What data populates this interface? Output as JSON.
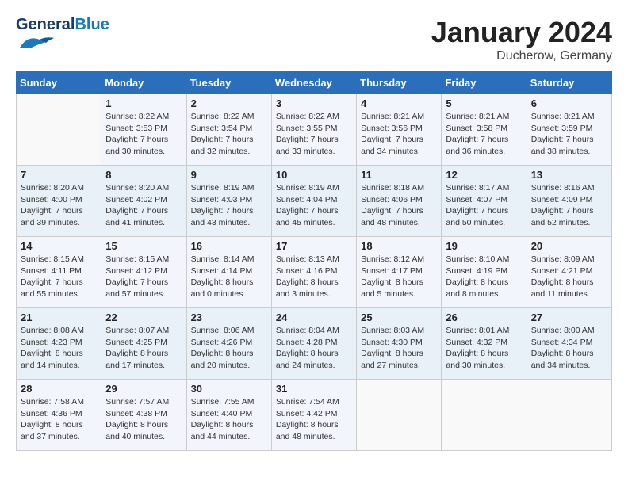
{
  "header": {
    "logo_general": "General",
    "logo_blue": "Blue",
    "month_title": "January 2024",
    "location": "Ducherow, Germany"
  },
  "days_of_week": [
    "Sunday",
    "Monday",
    "Tuesday",
    "Wednesday",
    "Thursday",
    "Friday",
    "Saturday"
  ],
  "weeks": [
    [
      {
        "day": "",
        "sunrise": "",
        "sunset": "",
        "daylight": ""
      },
      {
        "day": "1",
        "sunrise": "Sunrise: 8:22 AM",
        "sunset": "Sunset: 3:53 PM",
        "daylight": "Daylight: 7 hours and 30 minutes."
      },
      {
        "day": "2",
        "sunrise": "Sunrise: 8:22 AM",
        "sunset": "Sunset: 3:54 PM",
        "daylight": "Daylight: 7 hours and 32 minutes."
      },
      {
        "day": "3",
        "sunrise": "Sunrise: 8:22 AM",
        "sunset": "Sunset: 3:55 PM",
        "daylight": "Daylight: 7 hours and 33 minutes."
      },
      {
        "day": "4",
        "sunrise": "Sunrise: 8:21 AM",
        "sunset": "Sunset: 3:56 PM",
        "daylight": "Daylight: 7 hours and 34 minutes."
      },
      {
        "day": "5",
        "sunrise": "Sunrise: 8:21 AM",
        "sunset": "Sunset: 3:58 PM",
        "daylight": "Daylight: 7 hours and 36 minutes."
      },
      {
        "day": "6",
        "sunrise": "Sunrise: 8:21 AM",
        "sunset": "Sunset: 3:59 PM",
        "daylight": "Daylight: 7 hours and 38 minutes."
      }
    ],
    [
      {
        "day": "7",
        "sunrise": "Sunrise: 8:20 AM",
        "sunset": "Sunset: 4:00 PM",
        "daylight": "Daylight: 7 hours and 39 minutes."
      },
      {
        "day": "8",
        "sunrise": "Sunrise: 8:20 AM",
        "sunset": "Sunset: 4:02 PM",
        "daylight": "Daylight: 7 hours and 41 minutes."
      },
      {
        "day": "9",
        "sunrise": "Sunrise: 8:19 AM",
        "sunset": "Sunset: 4:03 PM",
        "daylight": "Daylight: 7 hours and 43 minutes."
      },
      {
        "day": "10",
        "sunrise": "Sunrise: 8:19 AM",
        "sunset": "Sunset: 4:04 PM",
        "daylight": "Daylight: 7 hours and 45 minutes."
      },
      {
        "day": "11",
        "sunrise": "Sunrise: 8:18 AM",
        "sunset": "Sunset: 4:06 PM",
        "daylight": "Daylight: 7 hours and 48 minutes."
      },
      {
        "day": "12",
        "sunrise": "Sunrise: 8:17 AM",
        "sunset": "Sunset: 4:07 PM",
        "daylight": "Daylight: 7 hours and 50 minutes."
      },
      {
        "day": "13",
        "sunrise": "Sunrise: 8:16 AM",
        "sunset": "Sunset: 4:09 PM",
        "daylight": "Daylight: 7 hours and 52 minutes."
      }
    ],
    [
      {
        "day": "14",
        "sunrise": "Sunrise: 8:15 AM",
        "sunset": "Sunset: 4:11 PM",
        "daylight": "Daylight: 7 hours and 55 minutes."
      },
      {
        "day": "15",
        "sunrise": "Sunrise: 8:15 AM",
        "sunset": "Sunset: 4:12 PM",
        "daylight": "Daylight: 7 hours and 57 minutes."
      },
      {
        "day": "16",
        "sunrise": "Sunrise: 8:14 AM",
        "sunset": "Sunset: 4:14 PM",
        "daylight": "Daylight: 8 hours and 0 minutes."
      },
      {
        "day": "17",
        "sunrise": "Sunrise: 8:13 AM",
        "sunset": "Sunset: 4:16 PM",
        "daylight": "Daylight: 8 hours and 3 minutes."
      },
      {
        "day": "18",
        "sunrise": "Sunrise: 8:12 AM",
        "sunset": "Sunset: 4:17 PM",
        "daylight": "Daylight: 8 hours and 5 minutes."
      },
      {
        "day": "19",
        "sunrise": "Sunrise: 8:10 AM",
        "sunset": "Sunset: 4:19 PM",
        "daylight": "Daylight: 8 hours and 8 minutes."
      },
      {
        "day": "20",
        "sunrise": "Sunrise: 8:09 AM",
        "sunset": "Sunset: 4:21 PM",
        "daylight": "Daylight: 8 hours and 11 minutes."
      }
    ],
    [
      {
        "day": "21",
        "sunrise": "Sunrise: 8:08 AM",
        "sunset": "Sunset: 4:23 PM",
        "daylight": "Daylight: 8 hours and 14 minutes."
      },
      {
        "day": "22",
        "sunrise": "Sunrise: 8:07 AM",
        "sunset": "Sunset: 4:25 PM",
        "daylight": "Daylight: 8 hours and 17 minutes."
      },
      {
        "day": "23",
        "sunrise": "Sunrise: 8:06 AM",
        "sunset": "Sunset: 4:26 PM",
        "daylight": "Daylight: 8 hours and 20 minutes."
      },
      {
        "day": "24",
        "sunrise": "Sunrise: 8:04 AM",
        "sunset": "Sunset: 4:28 PM",
        "daylight": "Daylight: 8 hours and 24 minutes."
      },
      {
        "day": "25",
        "sunrise": "Sunrise: 8:03 AM",
        "sunset": "Sunset: 4:30 PM",
        "daylight": "Daylight: 8 hours and 27 minutes."
      },
      {
        "day": "26",
        "sunrise": "Sunrise: 8:01 AM",
        "sunset": "Sunset: 4:32 PM",
        "daylight": "Daylight: 8 hours and 30 minutes."
      },
      {
        "day": "27",
        "sunrise": "Sunrise: 8:00 AM",
        "sunset": "Sunset: 4:34 PM",
        "daylight": "Daylight: 8 hours and 34 minutes."
      }
    ],
    [
      {
        "day": "28",
        "sunrise": "Sunrise: 7:58 AM",
        "sunset": "Sunset: 4:36 PM",
        "daylight": "Daylight: 8 hours and 37 minutes."
      },
      {
        "day": "29",
        "sunrise": "Sunrise: 7:57 AM",
        "sunset": "Sunset: 4:38 PM",
        "daylight": "Daylight: 8 hours and 40 minutes."
      },
      {
        "day": "30",
        "sunrise": "Sunrise: 7:55 AM",
        "sunset": "Sunset: 4:40 PM",
        "daylight": "Daylight: 8 hours and 44 minutes."
      },
      {
        "day": "31",
        "sunrise": "Sunrise: 7:54 AM",
        "sunset": "Sunset: 4:42 PM",
        "daylight": "Daylight: 8 hours and 48 minutes."
      },
      {
        "day": "",
        "sunrise": "",
        "sunset": "",
        "daylight": ""
      },
      {
        "day": "",
        "sunrise": "",
        "sunset": "",
        "daylight": ""
      },
      {
        "day": "",
        "sunrise": "",
        "sunset": "",
        "daylight": ""
      }
    ]
  ]
}
